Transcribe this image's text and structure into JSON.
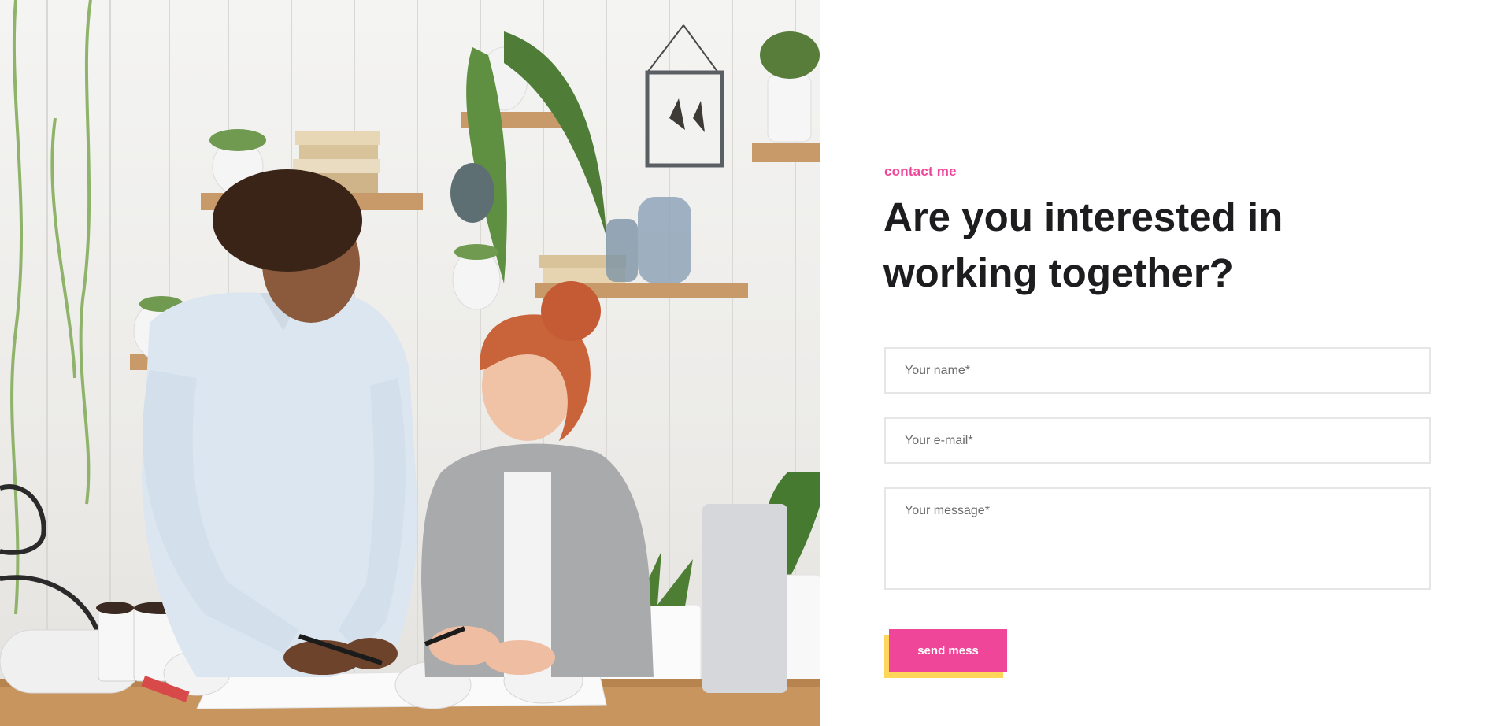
{
  "hero_image": {
    "alt": "Two colleagues working together at a desk"
  },
  "contact": {
    "eyebrow": "contact me",
    "headline": "Are you interested in working together?",
    "form": {
      "name_placeholder": "Your name*",
      "email_placeholder": "Your e-mail*",
      "message_placeholder": "Your message*",
      "name_value": "",
      "email_value": "",
      "message_value": "",
      "submit_label": "send mess"
    }
  },
  "colors": {
    "accent": "#f0469a",
    "button_shadow": "#ffd55a",
    "heading": "#1d1d1f",
    "input_border": "#e6e6e6"
  }
}
